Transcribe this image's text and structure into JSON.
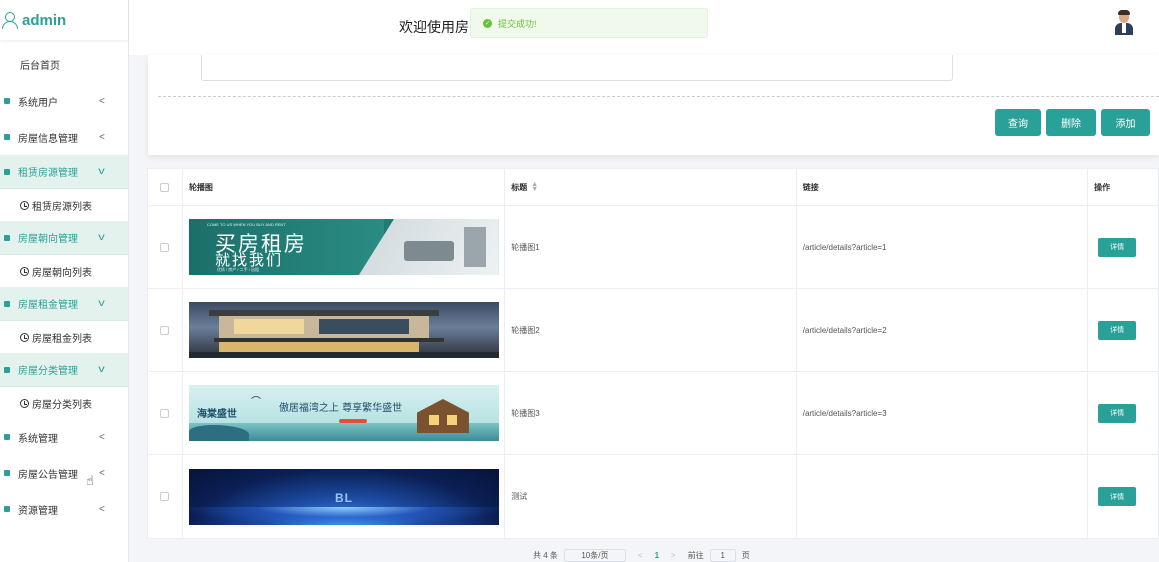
{
  "brand": {
    "title": "admin"
  },
  "header": {
    "welcome": "欢迎使用房"
  },
  "toast": {
    "message": "提交成功!"
  },
  "sidebar": {
    "home": "后台首页",
    "groups": [
      {
        "label": "系统用户",
        "arrow": "<"
      },
      {
        "label": "房屋信息管理",
        "arrow": "<"
      },
      {
        "label": "租赁房源管理",
        "arrow": "v",
        "sub": "租赁房源列表"
      },
      {
        "label": "房屋朝向管理",
        "arrow": "v",
        "sub": "房屋朝向列表"
      },
      {
        "label": "房屋租金管理",
        "arrow": "v",
        "sub": "房屋租金列表"
      },
      {
        "label": "房屋分类管理",
        "arrow": "v",
        "sub": "房屋分类列表"
      },
      {
        "label": "系统管理",
        "arrow": "<"
      },
      {
        "label": "房屋公告管理",
        "arrow": "<"
      },
      {
        "label": "资源管理",
        "arrow": "<"
      }
    ]
  },
  "toolbar": {
    "query": "查询",
    "delete": "删除",
    "add": "添加"
  },
  "table": {
    "headers": {
      "image": "轮播图",
      "title": "标题",
      "link": "链接",
      "action": "操作"
    },
    "rows": [
      {
        "title": "轮播图1",
        "link": "/article/details?article=1",
        "action": "详情",
        "banner": {
          "big": "买房租房",
          "small": "就找我们",
          "top": "COME TO US WHEN YOU BUY AND RENT",
          "tags": "优质 / 房产 / 二手 / 出租"
        }
      },
      {
        "title": "轮播图2",
        "link": "/article/details?article=2",
        "action": "详情"
      },
      {
        "title": "轮播图3",
        "link": "/article/details?article=3",
        "action": "详情",
        "banner": {
          "left": "海棠盛世",
          "center": "傲居福湾之上 尊享繁华盛世"
        }
      },
      {
        "title": "测试",
        "link": "",
        "action": "详情",
        "banner": {
          "center": "BL"
        }
      }
    ]
  },
  "pager": {
    "total": "共 4 条",
    "size": "10条/页",
    "prev": "<",
    "page": "1",
    "next": ">",
    "goto_label": "前往",
    "goto_value": "1",
    "page_unit": "页"
  },
  "colors": {
    "accent": "#2aa198",
    "toast_bg": "#f0f9eb",
    "toast_text": "#67c23a"
  }
}
